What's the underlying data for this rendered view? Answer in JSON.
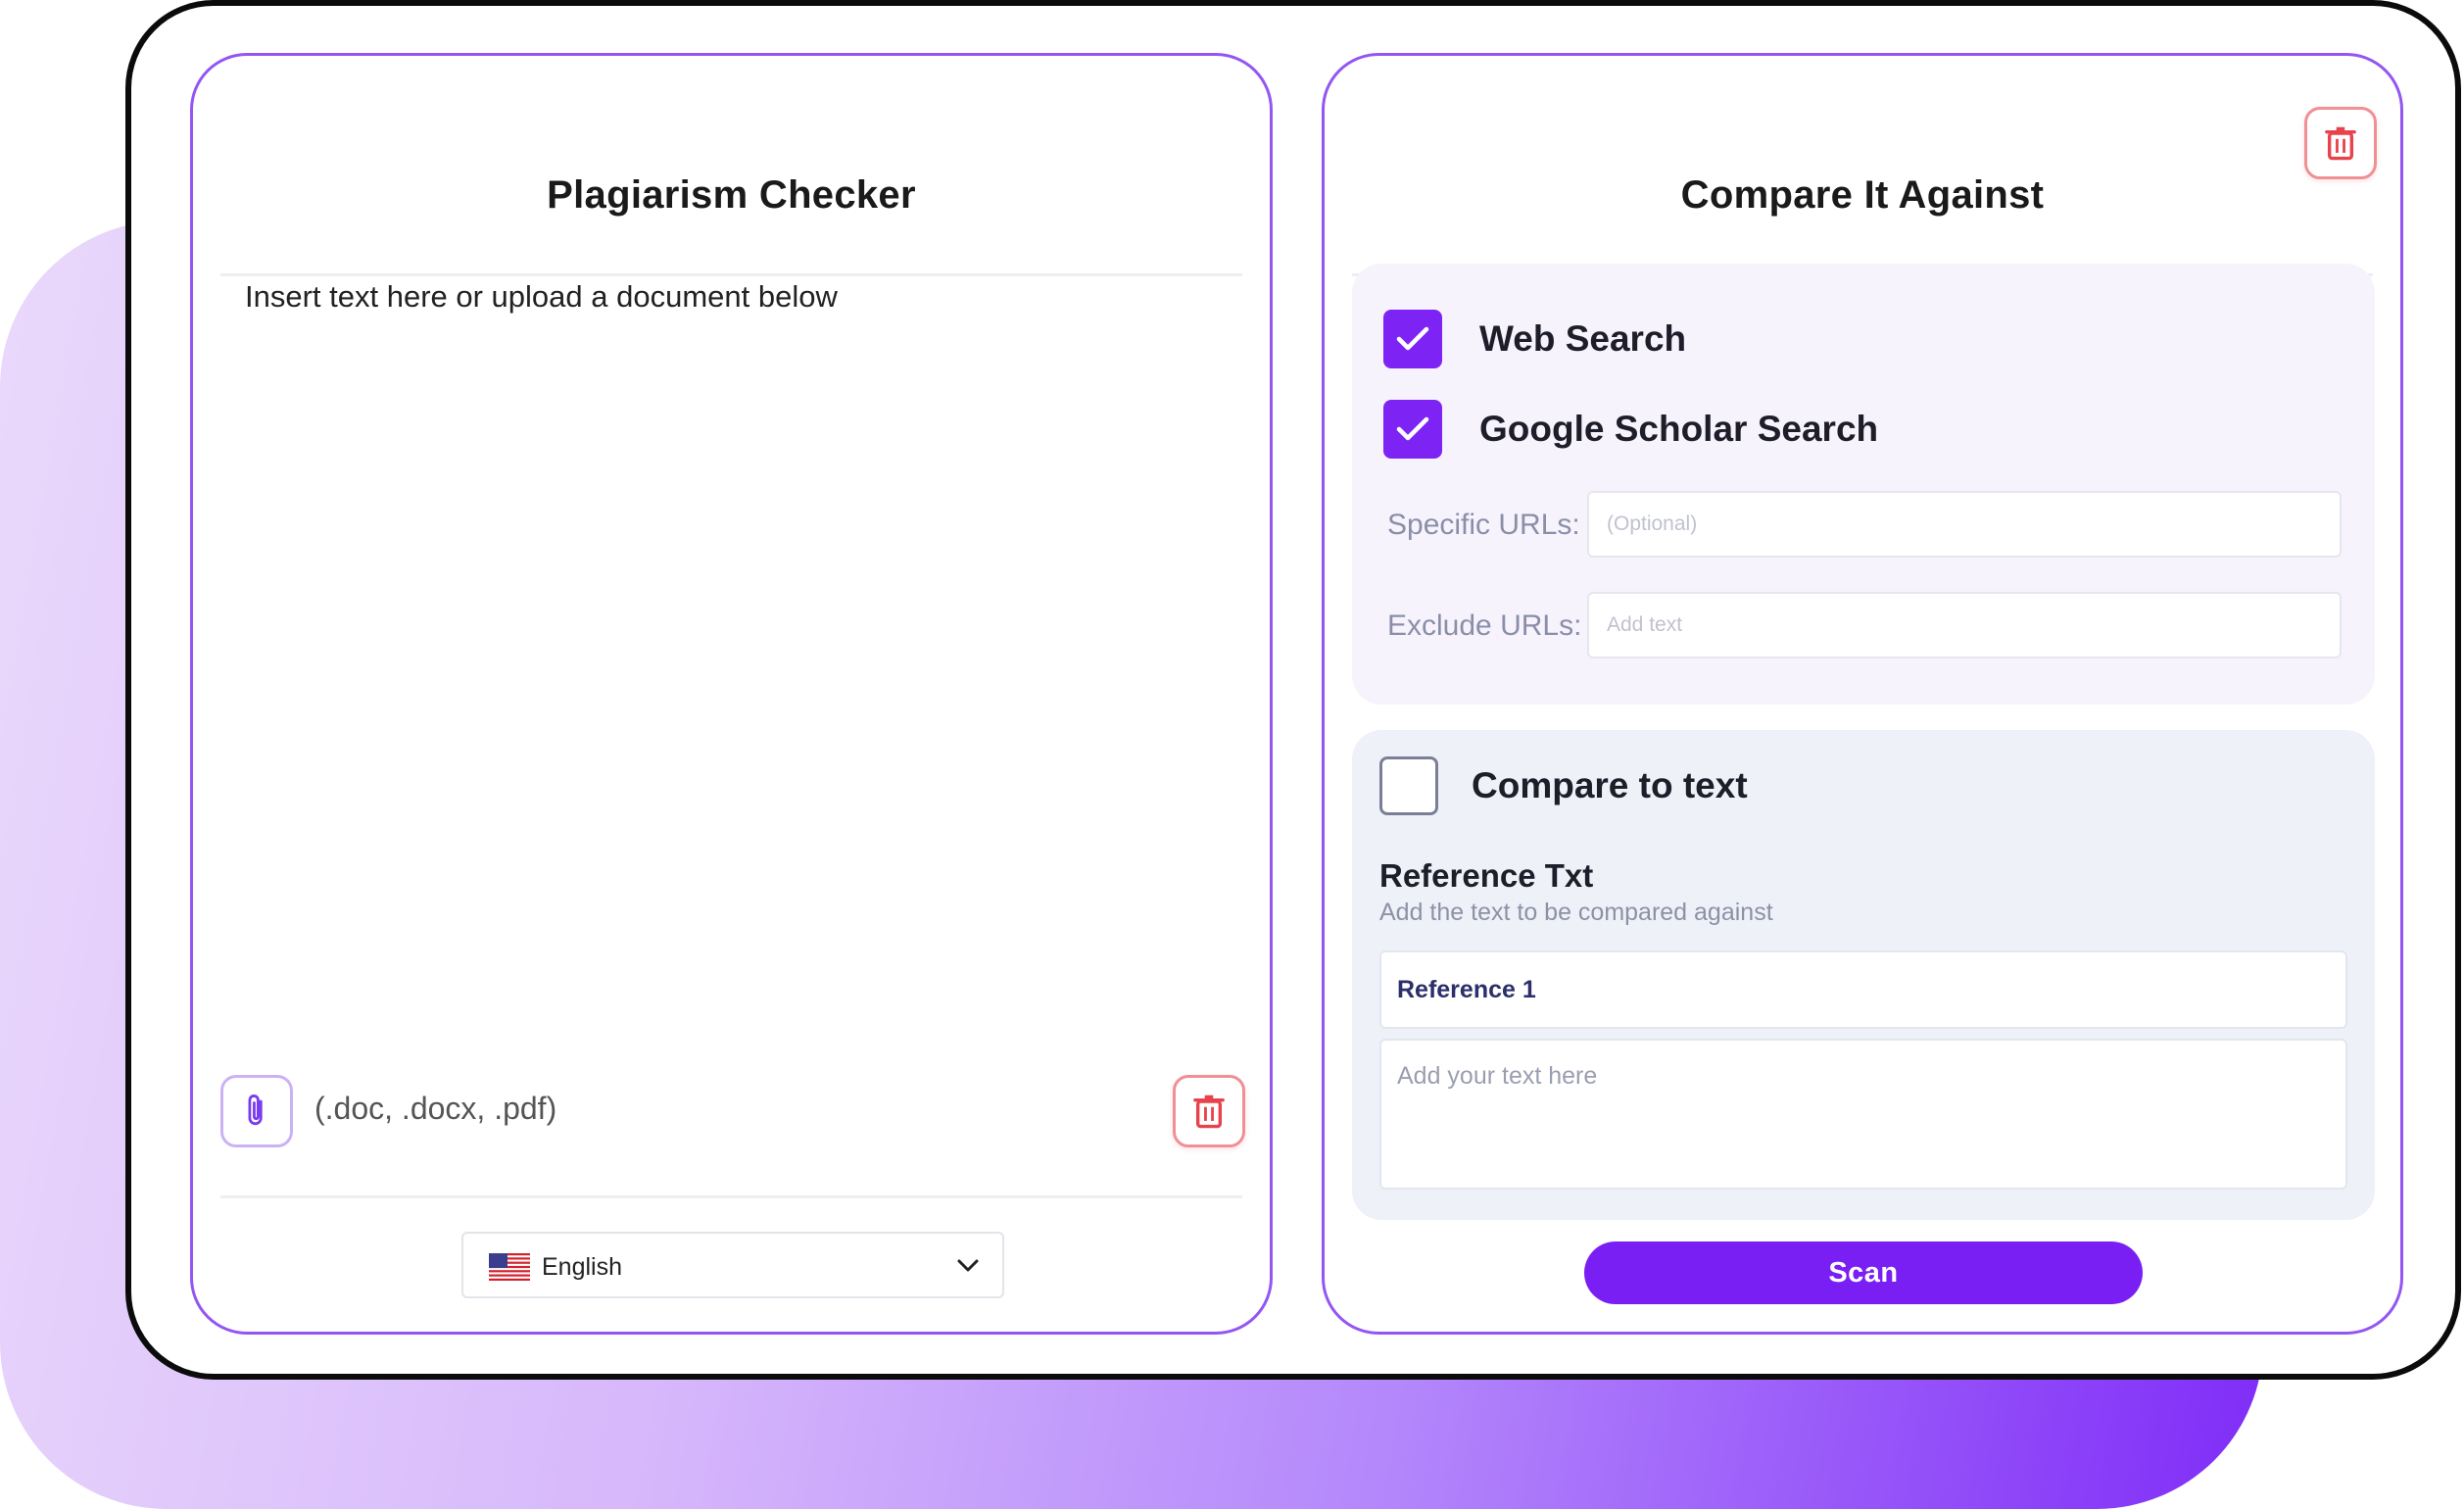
{
  "left_panel": {
    "title": "Plagiarism Checker",
    "editor_placeholder": "Insert text here or upload a document below",
    "upload_formats": "(.doc, .docx, .pdf)",
    "upload_icon": "paperclip-icon",
    "delete_icon": "trash-icon",
    "language": {
      "selected": "English",
      "flag": "us-flag-icon",
      "chevron": "chevron-down-icon"
    }
  },
  "right_panel": {
    "title": "Compare It Against",
    "delete_icon": "trash-icon",
    "search_options": {
      "web_search": {
        "label": "Web Search",
        "checked": true
      },
      "scholar_search": {
        "label": "Google Scholar Search",
        "checked": true
      },
      "specific_urls": {
        "label": "Specific URLs:",
        "placeholder": "(Optional)"
      },
      "exclude_urls": {
        "label": "Exclude URLs:",
        "placeholder": "Add text"
      }
    },
    "compare_text": {
      "label": "Compare to text",
      "checked": false,
      "reference_title": "Reference Txt",
      "reference_subtitle": "Add the text to be compared against",
      "reference_tab": "Reference 1",
      "text_placeholder": "Add your text here"
    },
    "scan_label": "Scan"
  },
  "colors": {
    "accent": "#7a1ff4",
    "panel_border": "#9456f3",
    "delete_red": "#e8434c",
    "backdrop_start": "#ead9fb",
    "backdrop_end": "#7f2cf7"
  }
}
